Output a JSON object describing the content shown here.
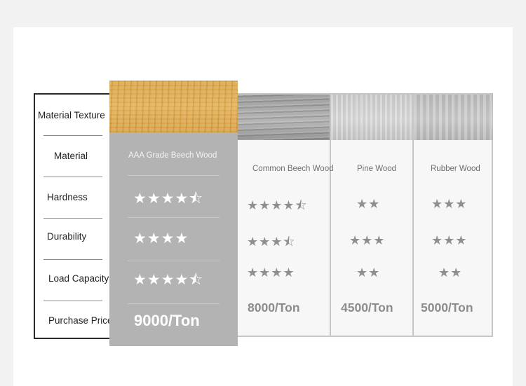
{
  "row_labels": {
    "texture": "Material Texture",
    "material": "Material",
    "hardness": "Hardness",
    "durability": "Durability",
    "load_capacity": "Load Capacity",
    "price": "Purchase Price"
  },
  "products": [
    {
      "material": "AAA Grade Beech Wood",
      "hardness": "★★★★⯪",
      "durability": "★★★★",
      "load_capacity": "★★★★⯪",
      "price": "9000/Ton",
      "texture_color": "#dca84c",
      "highlighted": true
    },
    {
      "material": "Common Beech Wood",
      "hardness": "★★★★⯪",
      "durability": "★★★⯪",
      "load_capacity": "★★★★",
      "price": "8000/Ton",
      "texture_color": "#a3a3a3",
      "highlighted": false
    },
    {
      "material": "Pine Wood",
      "hardness": "★★",
      "durability": "★★★",
      "load_capacity": "★★",
      "price": "4500/Ton",
      "texture_color": "#d4d4d4",
      "highlighted": false
    },
    {
      "material": "Rubber Wood",
      "hardness": "★★★",
      "durability": "★★★",
      "load_capacity": "★★",
      "price": "5000/Ton",
      "texture_color": "#c4c4c4",
      "highlighted": false
    }
  ],
  "colors": {
    "highlight_panel": "#b3b3b3",
    "background": "#f2f2f2",
    "card": "#ffffff",
    "other_text": "#8f8f8f"
  }
}
